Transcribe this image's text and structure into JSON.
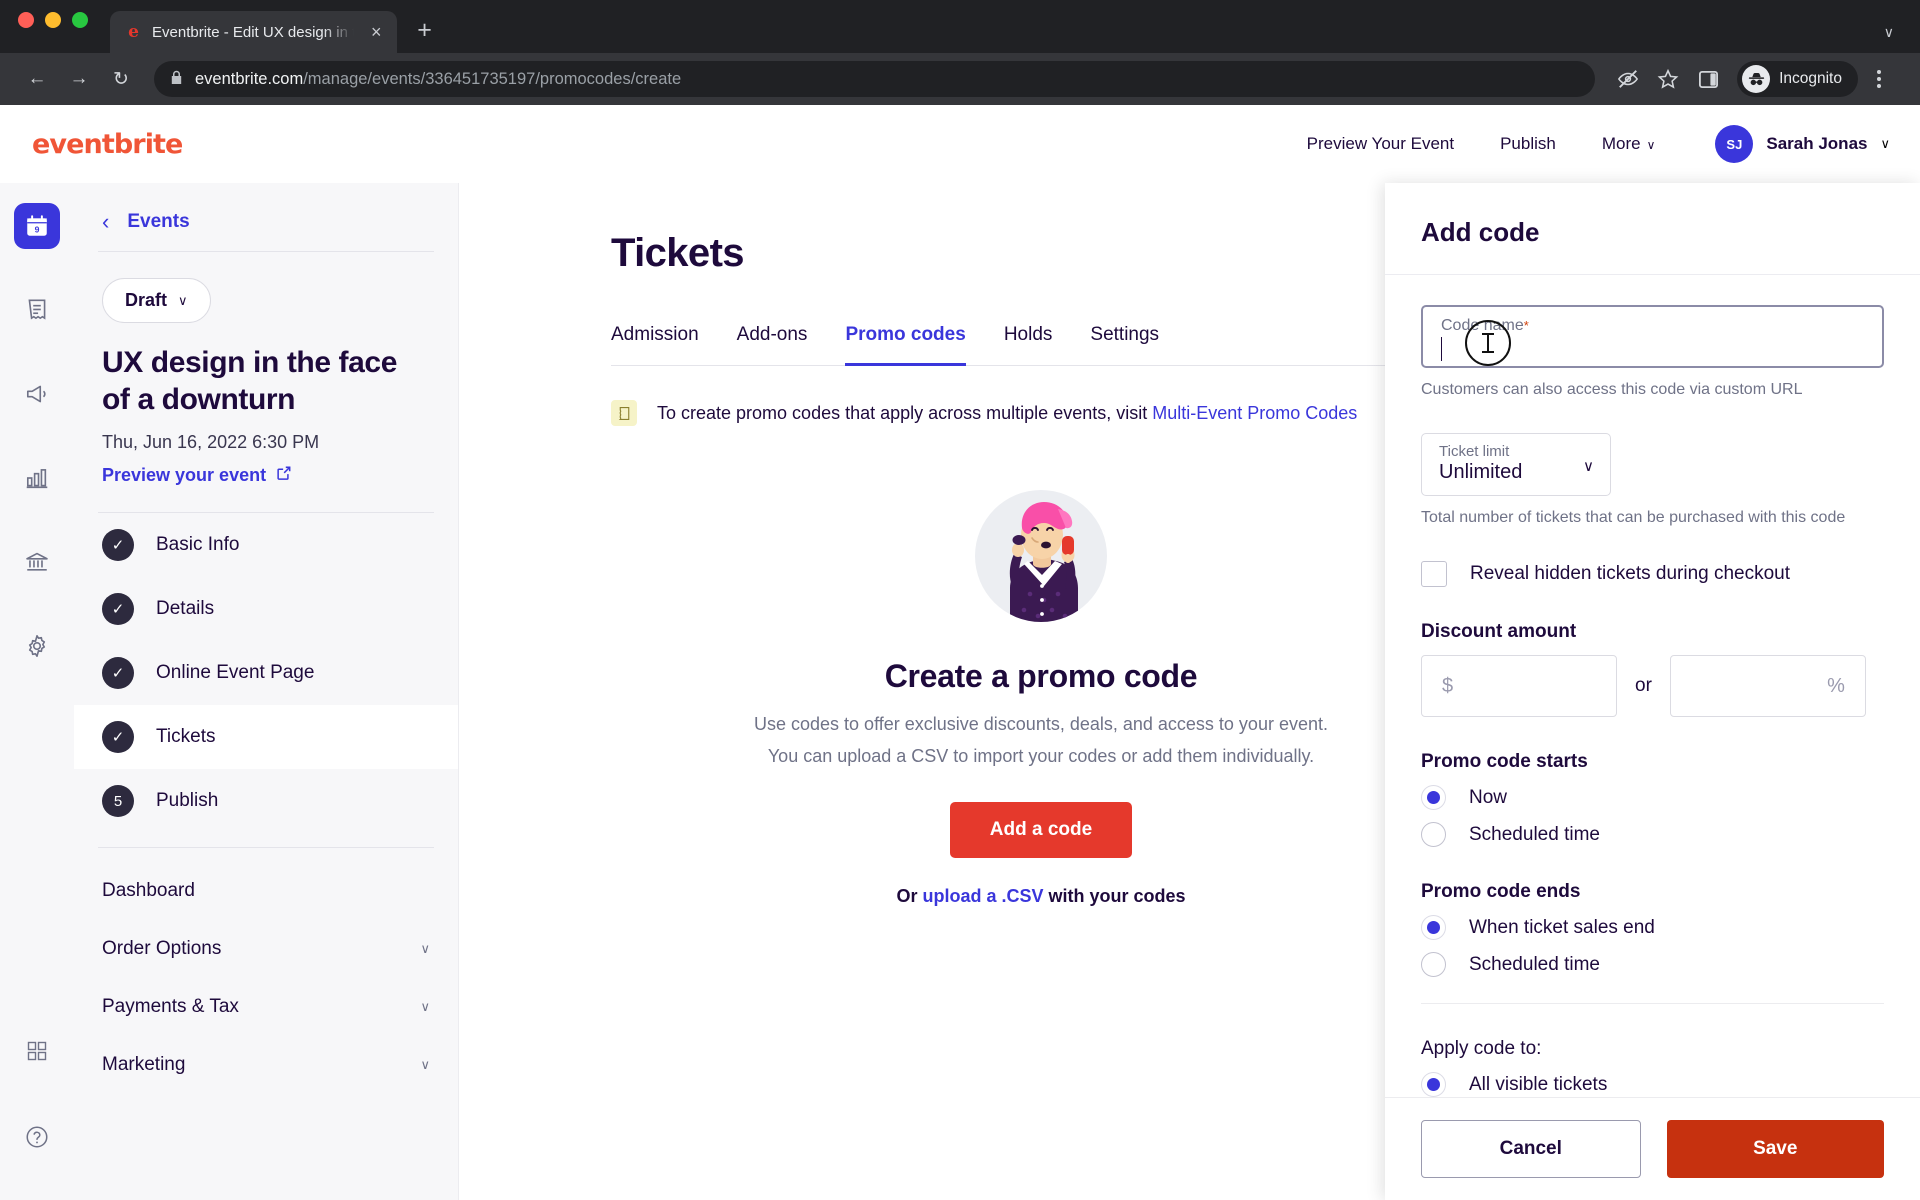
{
  "browser": {
    "tab_title": "Eventbrite - Edit UX design in t",
    "favicon_letter": "e",
    "close_icon": "×",
    "newtab_icon": "+",
    "window_chevron": "∨",
    "back_icon": "←",
    "forward_icon": "→",
    "reload_icon": "↻",
    "lock_icon": "🔒",
    "url_domain": "eventbrite.com",
    "url_path": "/manage/events/336451735197/promocodes/create",
    "profile_label": "Incognito"
  },
  "header": {
    "logo": "eventbrite",
    "nav": [
      {
        "label": "Preview Your Event",
        "chevron": ""
      },
      {
        "label": "Publish",
        "chevron": ""
      },
      {
        "label": "More",
        "chevron": "∨"
      }
    ],
    "user": {
      "initials": "SJ",
      "name": "Sarah Jonas",
      "chevron": "∨"
    }
  },
  "rail": {
    "items": [
      {
        "name": "calendar",
        "active": true
      },
      {
        "name": "orders",
        "active": false
      },
      {
        "name": "marketing",
        "active": false
      },
      {
        "name": "reports",
        "active": false
      },
      {
        "name": "finance",
        "active": false
      },
      {
        "name": "settings",
        "active": false
      }
    ],
    "bottom": [
      {
        "name": "apps"
      },
      {
        "name": "help"
      }
    ]
  },
  "sidebar": {
    "back_label": "Events",
    "back_chevron": "‹",
    "status_pill": {
      "label": "Draft",
      "chevron": "∨"
    },
    "event_title": "UX design in the face of a downturn",
    "event_date": "Thu, Jun 16, 2022 6:30 PM",
    "preview_link": "Preview your event",
    "preview_icon": "↗",
    "steps": [
      {
        "label": "Basic Info",
        "badge": "✓",
        "current": false
      },
      {
        "label": "Details",
        "badge": "✓",
        "current": false
      },
      {
        "label": "Online Event Page",
        "badge": "✓",
        "current": false
      },
      {
        "label": "Tickets",
        "badge": "✓",
        "current": true
      },
      {
        "label": "Publish",
        "badge": "5",
        "current": false
      }
    ],
    "links": [
      {
        "label": "Dashboard",
        "chevron": ""
      },
      {
        "label": "Order Options",
        "chevron": "∨"
      },
      {
        "label": "Payments & Tax",
        "chevron": "∨"
      },
      {
        "label": "Marketing",
        "chevron": "∨"
      }
    ]
  },
  "main": {
    "page_title": "Tickets",
    "tabs": [
      {
        "label": "Admission",
        "active": false
      },
      {
        "label": "Add-ons",
        "active": false
      },
      {
        "label": "Promo codes",
        "active": true
      },
      {
        "label": "Holds",
        "active": false
      },
      {
        "label": "Settings",
        "active": false
      }
    ],
    "banner": {
      "text": "To create promo codes that apply across multiple events, visit ",
      "link": "Multi-Event Promo Codes"
    },
    "empty_state": {
      "heading": "Create a promo code",
      "description": "Use codes to offer exclusive discounts, deals, and access to your event. You can upload a CSV to import your codes or add them individually.",
      "primary_button": "Add a code",
      "footer_prefix": "Or ",
      "footer_link": "upload a .CSV",
      "footer_suffix": " with your codes"
    }
  },
  "panel": {
    "title": "Add code",
    "code_name": {
      "label": "Code name",
      "required_mark": "*",
      "value": "",
      "help": "Customers can also access this code via custom URL"
    },
    "ticket_limit": {
      "label": "Ticket limit",
      "value": "Unlimited",
      "chevron": "∨",
      "help": "Total number of tickets that can be purchased with this code"
    },
    "reveal_hidden": {
      "label": "Reveal hidden tickets during checkout",
      "checked": false
    },
    "discount": {
      "title": "Discount amount",
      "currency_symbol": "$",
      "currency_value": "",
      "percent_symbol": "%",
      "percent_value": "",
      "separator": "or"
    },
    "starts": {
      "title": "Promo code starts",
      "options": [
        {
          "label": "Now",
          "selected": true
        },
        {
          "label": "Scheduled time",
          "selected": false
        }
      ]
    },
    "ends": {
      "title": "Promo code ends",
      "options": [
        {
          "label": "When ticket sales end",
          "selected": true
        },
        {
          "label": "Scheduled time",
          "selected": false
        }
      ]
    },
    "apply_to": {
      "title": "Apply code to:",
      "options": [
        {
          "label": "All visible tickets",
          "selected": true
        }
      ]
    },
    "footer": {
      "cancel": "Cancel",
      "save": "Save"
    }
  },
  "colors": {
    "brand_orange": "#f05537",
    "accent_blue": "#3a36db",
    "primary_red": "#e5392c",
    "save_red": "#c6310f",
    "ink": "#1e0a3c"
  }
}
